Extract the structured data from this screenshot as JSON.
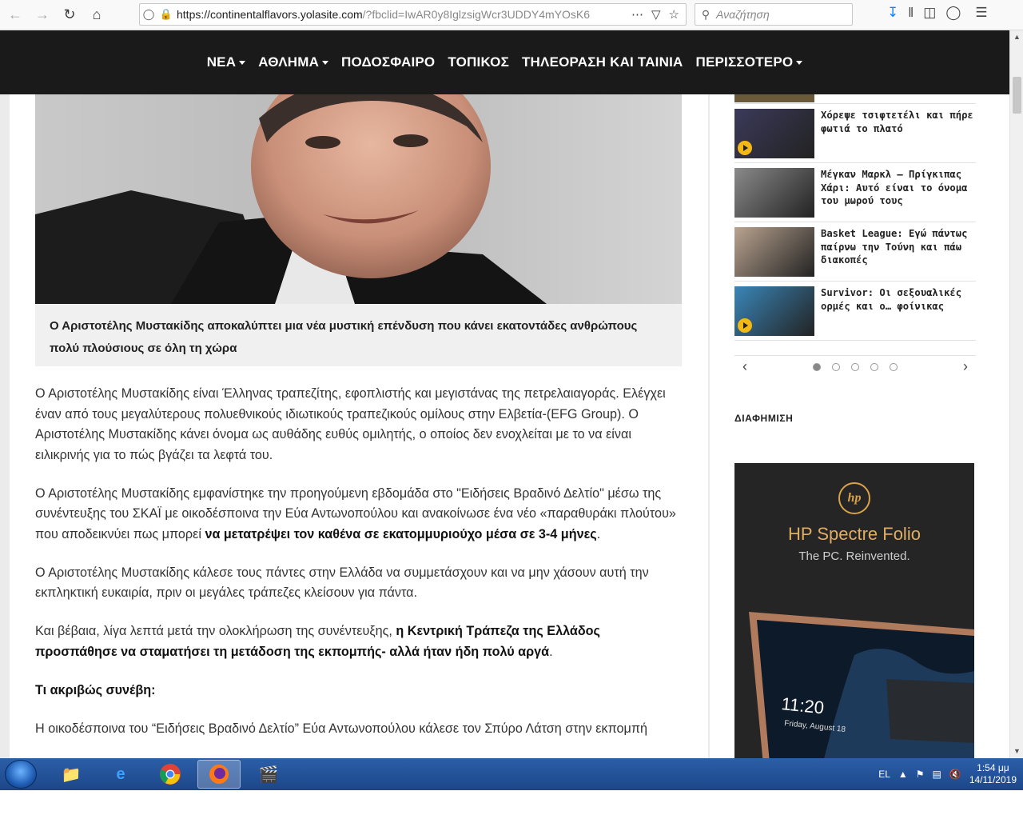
{
  "browser": {
    "url": "https://continentalflavors.yolasite.com/?fbclid=IwAR0y8IglzsigWcr3UDDY4mYOsK6",
    "url_host": "https://continentalflavors.yolasite.com",
    "url_rest": "/?fbclid=IwAR0y8IglzsigWcr3UDDY4mYOsK6",
    "search_placeholder": "Αναζήτηση"
  },
  "nav": {
    "items": [
      {
        "label": "ΝΕΑ",
        "dropdown": true
      },
      {
        "label": "ΑΘΛΗΜΑ",
        "dropdown": true
      },
      {
        "label": "ΠΟΔΟΣΦΑΙΡΟ",
        "dropdown": false
      },
      {
        "label": "ΤΟΠΙΚΟΣ",
        "dropdown": false
      },
      {
        "label": "ΤΗΛΕΟΡΑΣΗ ΚΑΙ ΤΑΙΝΙΑ",
        "dropdown": false
      },
      {
        "label": "ΠΕΡΙΣΣΟΤΕΡΟ",
        "dropdown": true
      }
    ]
  },
  "article": {
    "caption": "Ο Αριστοτέλης Μυστακίδης αποκαλύπτει μια νέα μυστική επένδυση που κάνει εκατοντάδες ανθρώπους πολύ πλούσιους σε όλη τη χώρα",
    "p1": "Ο Αριστοτέλης Μυστακίδης είναι Έλληνας τραπεζίτης, εφοπλιστής και μεγιστάνας της πετρελαιαγοράς. Ελέγχει έναν από τους μεγαλύτερους πολυεθνικούς ιδιωτικούς τραπεζικούς ομίλους στην Ελβετία-(EFG Group). Ο Αριστοτέλης Μυστακίδης κάνει όνομα ως αυθάδης ευθύς ομιλητής, ο οποίος δεν ενοχλείται με το να είναι ειλικρινής για το πώς βγάζει τα λεφτά του.",
    "p2_a": "Ο Αριστοτέλης Μυστακίδης εμφανίστηκε την προηγούμενη εβδομάδα στο \"Ειδήσεις Βραδινό Δελτίο\" μέσω της συνέντευξης του ΣΚΑΪ με οικοδέσποινα την Εύα Αντωνοπούλου και ανακοίνωσε ένα νέο «παραθυράκι πλούτου» που αποδεικνύει πως μπορεί ",
    "p2_b": "να μετατρέψει τον καθένα σε εκατομμυριούχο μέσα σε 3-4 μήνες",
    "p2_c": ".",
    "p3": "Ο Αριστοτέλης Μυστακίδης κάλεσε τους πάντες στην Ελλάδα να συμμετάσχουν και να μην χάσουν αυτή την εκπληκτική ευκαιρία, πριν οι μεγάλες τράπεζες κλείσουν για πάντα.",
    "p4_a": "Και βέβαια, λίγα λεπτά μετά την ολοκλήρωση της συνέντευξης, ",
    "p4_b": "η Κεντρική Τράπεζα της Ελλάδος προσπάθησε να σταματήσει τη μετάδοση της εκπομπής- αλλά ήταν ήδη πολύ αργά",
    "p4_c": ".",
    "subhead": "Τι ακριβώς συνέβη:",
    "p5": "Η οικοδέσποινα του “Ειδήσεις Βραδινό Δελτίο” Εύα Αντωνοπούλου κάλεσε τον Σπύρο Λάτση στην εκπομπή"
  },
  "sidebar": {
    "news": [
      {
        "title": "Χόρεψε τσιφτετέλι και πήρε φωτιά το πλατό",
        "video": true
      },
      {
        "title": "Μέγκαν Μαρκλ – Πρίγκιπας Χάρι: Αυτό είναι το όνομα του μωρού τους",
        "video": false
      },
      {
        "title": "Basket League: Εγώ πάντως παίρνω την Τούνη και πάω διακοπές",
        "video": false
      },
      {
        "title": "Survivor: Οι σεξουαλικές ορμές και ο… φοίνικας",
        "video": true
      }
    ],
    "pager_dots": 5,
    "pager_active": 1,
    "ad_label": "ΔΙΑΦΗΜΙΣΗ",
    "ad": {
      "logo": "hp",
      "title": "HP Spectre Folio",
      "subtitle": "The PC. Reinvented.",
      "screen_time": "11:20",
      "screen_date": "Friday, August 18"
    }
  },
  "taskbar": {
    "language": "EL",
    "time": "1:54 μμ",
    "date": "14/11/2019"
  }
}
